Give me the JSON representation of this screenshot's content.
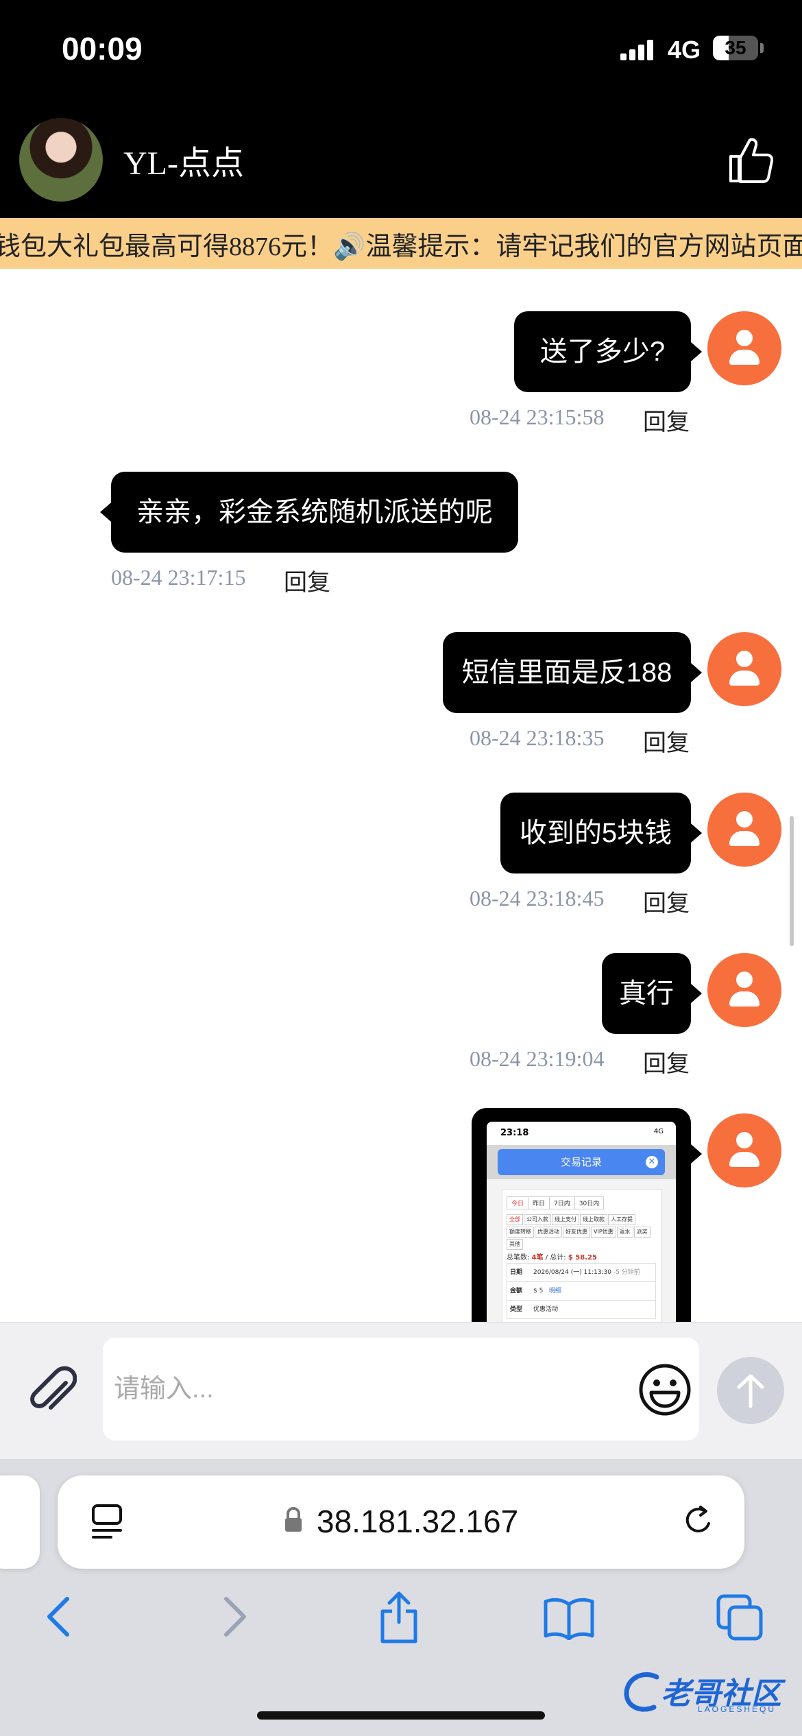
{
  "status": {
    "time": "00:09",
    "network": "4G",
    "battery": "35",
    "battery_level": 0.35
  },
  "header": {
    "title": "YL-点点"
  },
  "marquee": {
    "text": "钱包大礼包最高可得8876元！🔊温馨提示：请牢记我们的官方网站页面"
  },
  "messages": [
    {
      "side": "right",
      "text": "送了多少?",
      "time": "08-24 23:15:58",
      "reply": "回复"
    },
    {
      "side": "left",
      "text": "亲亲，彩金系统随机派送的呢",
      "time": "08-24 23:17:15",
      "reply": "回复"
    },
    {
      "side": "right",
      "text": "短信里面是反188",
      "time": "08-24 23:18:35",
      "reply": "回复"
    },
    {
      "side": "right",
      "text": "收到的5块钱",
      "time": "08-24 23:18:45",
      "reply": "回复"
    },
    {
      "side": "right",
      "text": "真行",
      "time": "08-24 23:19:04",
      "reply": "回复"
    }
  ],
  "image_message": {
    "status_time": "23:18",
    "status_right": "4G",
    "header": "交易记录",
    "close": "✕",
    "tabs": [
      "今日",
      "昨日",
      "7日内",
      "30日内"
    ],
    "categories": [
      "全部",
      "公司入款",
      "线上支付",
      "线上取款",
      "人工存提",
      "额度转移",
      "优惠活动",
      "好友优惠",
      "VIP优惠",
      "返水",
      "派奖",
      "其他"
    ],
    "total_label": "总笔数:",
    "total_count": "4笔",
    "total_sep": "/ 总计:",
    "total_amount": "$ 58.25",
    "rows": [
      {
        "label": "日期",
        "value": "2026/08/24 (一) 11:13:30",
        "extra": "-5 分钟前"
      },
      {
        "label": "金额",
        "value": "$ 5",
        "extra": "明细"
      },
      {
        "label": "类型",
        "value": "优惠活动",
        "extra": ""
      }
    ]
  },
  "input": {
    "placeholder": "请输入..."
  },
  "browser": {
    "url": "38.181.32.167"
  },
  "watermark": {
    "text": "老哥社区",
    "sub": "LAOGESHEQU"
  },
  "colors": {
    "accent": "#f86f3e",
    "bubble": "#000000",
    "marquee_bg": "#f9cf8a"
  }
}
